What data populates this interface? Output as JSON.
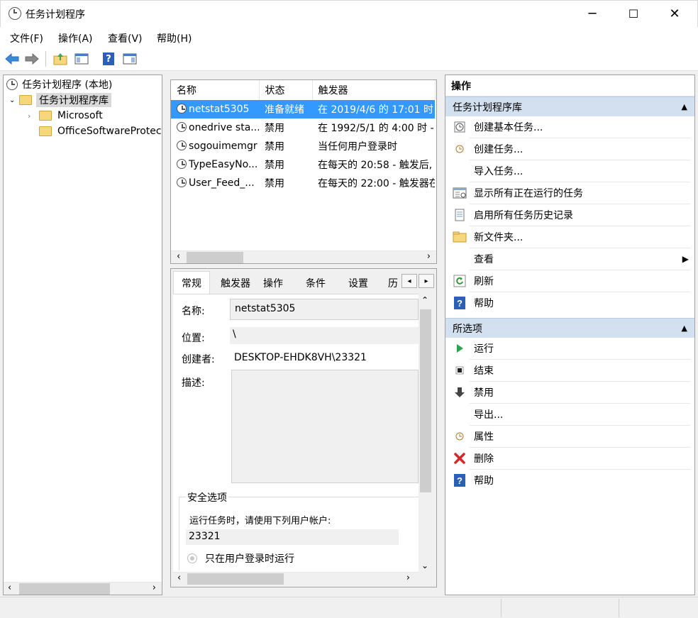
{
  "window": {
    "title": "任务计划程序",
    "minimize": "─",
    "maximize": "☐",
    "close": "✕"
  },
  "menu": [
    "文件(F)",
    "操作(A)",
    "查看(V)",
    "帮助(H)"
  ],
  "toolbar": {
    "help_glyph": "?"
  },
  "tree": {
    "root": "任务计划程序 (本地)",
    "library": "任务计划程序库",
    "children": [
      "Microsoft",
      "OfficeSoftwareProtec"
    ]
  },
  "task_list": {
    "columns": [
      "名称",
      "状态",
      "触发器"
    ],
    "rows": [
      [
        "netstat5305",
        "准备就绪",
        "在 2019/4/6 的 17:01 时"
      ],
      [
        "onedrive sta...",
        "禁用",
        "在 1992/5/1 的 4:00 时 -"
      ],
      [
        "sogouimemgr",
        "禁用",
        "当任何用户登录时"
      ],
      [
        "TypeEasyNo...",
        "禁用",
        "在每天的 20:58 - 触发后,"
      ],
      [
        "User_Feed_...",
        "禁用",
        "在每天的 22:00 - 触发器在"
      ]
    ]
  },
  "detail": {
    "tabs": [
      "常规",
      "触发器",
      "操作",
      "条件",
      "设置",
      "历"
    ],
    "name_label": "名称:",
    "name_value": "netstat5305",
    "location_label": "位置:",
    "location_value": "\\",
    "author_label": "创建者:",
    "author_value": "DESKTOP-EHDK8VH\\23321",
    "desc_label": "描述:",
    "security_title": "安全选项",
    "security_run_as": "运行任务时，请使用下列用户帐户:",
    "security_user": "23321",
    "radio_logged_on": "只在用户登录时运行"
  },
  "actions": {
    "header": "操作",
    "library_section": "任务计划程序库",
    "library_items": [
      {
        "label": "创建基本任务...",
        "icon": "create-basic-task-icon"
      },
      {
        "label": "创建任务...",
        "icon": "create-task-icon"
      },
      {
        "label": "导入任务...",
        "icon": ""
      },
      {
        "label": "显示所有正在运行的任务",
        "icon": "running-tasks-icon"
      },
      {
        "label": "启用所有任务历史记录",
        "icon": "history-icon"
      },
      {
        "label": "新文件夹...",
        "icon": "folder-icon"
      },
      {
        "label": "查看",
        "icon": ""
      },
      {
        "label": "刷新",
        "icon": "refresh-icon"
      },
      {
        "label": "帮助",
        "icon": "help-icon"
      }
    ],
    "selected_section": "所选项",
    "selected_items": [
      {
        "label": "运行",
        "icon": "run-icon"
      },
      {
        "label": "结束",
        "icon": "end-icon"
      },
      {
        "label": "禁用",
        "icon": "disable-icon"
      },
      {
        "label": "导出...",
        "icon": ""
      },
      {
        "label": "属性",
        "icon": "properties-icon"
      },
      {
        "label": "删除",
        "icon": "delete-icon"
      },
      {
        "label": "帮助",
        "icon": "help-icon"
      }
    ]
  },
  "colors": {
    "selection": "#3399ff",
    "section_header": "#d3e0ef"
  }
}
